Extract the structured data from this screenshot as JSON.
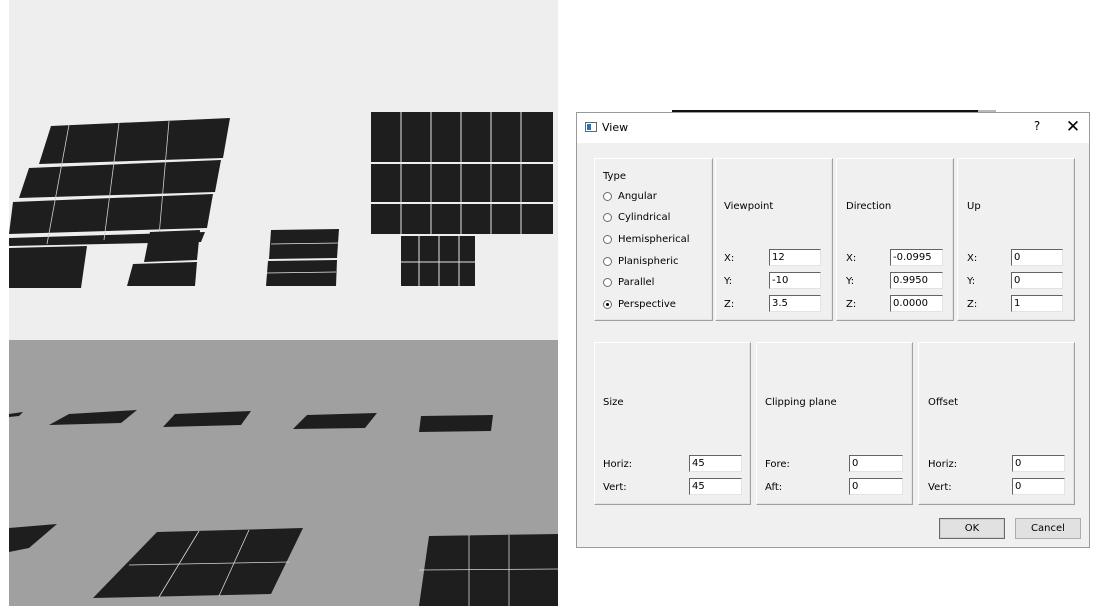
{
  "viewport": {
    "sky_color": "#eeeeee",
    "ground_color": "#a0a0a0",
    "panel_color": "#1e1e1e",
    "grid_color": "#f2f2f2"
  },
  "dialog": {
    "title": "View",
    "help_label": "?",
    "close_label": "✕",
    "type": {
      "heading": "Type",
      "options": [
        "Angular",
        "Cylindrical",
        "Hemispherical",
        "Planispheric",
        "Parallel",
        "Perspective"
      ],
      "selected": "Perspective"
    },
    "viewpoint": {
      "heading": "Viewpoint",
      "x_label": "X:",
      "y_label": "Y:",
      "z_label": "Z:",
      "x": "12",
      "y": "-10",
      "z": "3.5"
    },
    "direction": {
      "heading": "Direction",
      "x_label": "X:",
      "y_label": "Y:",
      "z_label": "Z:",
      "x": "-0.0995",
      "y": "0.9950",
      "z": "0.0000"
    },
    "up": {
      "heading": "Up",
      "x_label": "X:",
      "y_label": "Y:",
      "z_label": "Z:",
      "x": "0",
      "y": "0",
      "z": "1"
    },
    "size": {
      "heading": "Size",
      "horiz_label": "Horiz:",
      "vert_label": "Vert:",
      "horiz": "45",
      "vert": "45"
    },
    "clipping": {
      "heading": "Clipping plane",
      "fore_label": "Fore:",
      "aft_label": "Aft:",
      "fore": "0",
      "aft": "0"
    },
    "offset": {
      "heading": "Offset",
      "horiz_label": "Horiz:",
      "vert_label": "Vert:",
      "horiz": "0",
      "vert": "0"
    },
    "ok_label": "OK",
    "cancel_label": "Cancel"
  }
}
